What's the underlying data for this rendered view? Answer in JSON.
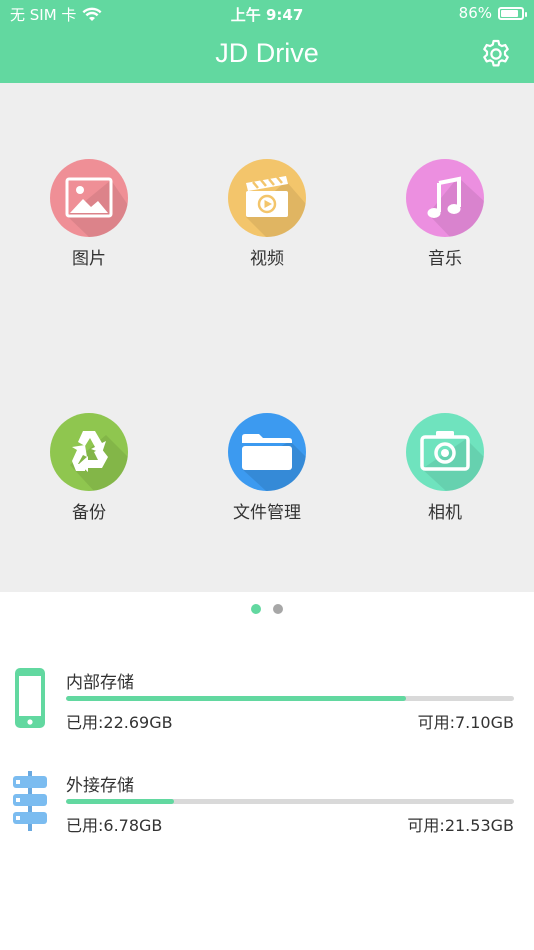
{
  "status_bar": {
    "carrier": "无 SIM 卡",
    "time": "上午 9:47",
    "battery": "86%",
    "battery_level": 0.86
  },
  "header": {
    "title": "JD Drive",
    "settings_icon": "gear-icon",
    "color": "#62d8a0"
  },
  "categories": [
    {
      "label": "图片",
      "icon": "image-icon",
      "color": "#ef8f96"
    },
    {
      "label": "视频",
      "icon": "video-clapper-icon",
      "color": "#f3c56b"
    },
    {
      "label": "音乐",
      "icon": "music-note-icon",
      "color": "#ec8fe0"
    },
    {
      "label": "备份",
      "icon": "recycle-icon",
      "color": "#8fc64f"
    },
    {
      "label": "文件管理",
      "icon": "folder-icon",
      "color": "#3c9af0"
    },
    {
      "label": "相机",
      "icon": "camera-icon",
      "color": "#6fe3be"
    }
  ],
  "pager": {
    "pages": 2,
    "current": 1
  },
  "storage": [
    {
      "name": "内部存储",
      "used": "已用:22.69GB",
      "free": "可用:7.10GB",
      "used_fraction": 0.76,
      "icon": "phone-icon"
    },
    {
      "name": "外接存储",
      "used": "已用:6.78GB",
      "free": "可用:21.53GB",
      "used_fraction": 0.24,
      "icon": "server-icon"
    }
  ]
}
